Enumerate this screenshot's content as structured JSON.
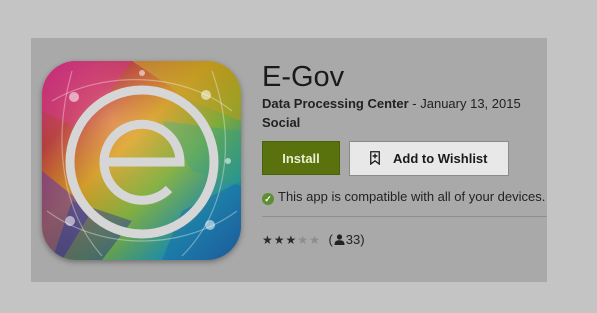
{
  "app": {
    "title": "E-Gov",
    "developer": "Data Processing Center",
    "date_separator": " - ",
    "date": "January 13, 2015",
    "category": "Social"
  },
  "buttons": {
    "install_label": "Install",
    "wishlist_label": "Add to Wishlist"
  },
  "compatibility": {
    "text": "This app is compatible with all of your devices."
  },
  "rating": {
    "stars_filled": 3,
    "stars_total": 5,
    "open_paren": "(",
    "count": "33",
    "close_paren": ")"
  },
  "icons": {
    "app_logo": "e-gov-logo-icon",
    "bookmark": "bookmark-plus-icon",
    "check": "check-circle-icon",
    "person": "person-icon",
    "star": "star-icon"
  },
  "colors": {
    "install_button": "#59720e",
    "compat_check": "#5c8f2f",
    "page_background": "#c4c4c4",
    "card_background": "#a9a9a9"
  }
}
